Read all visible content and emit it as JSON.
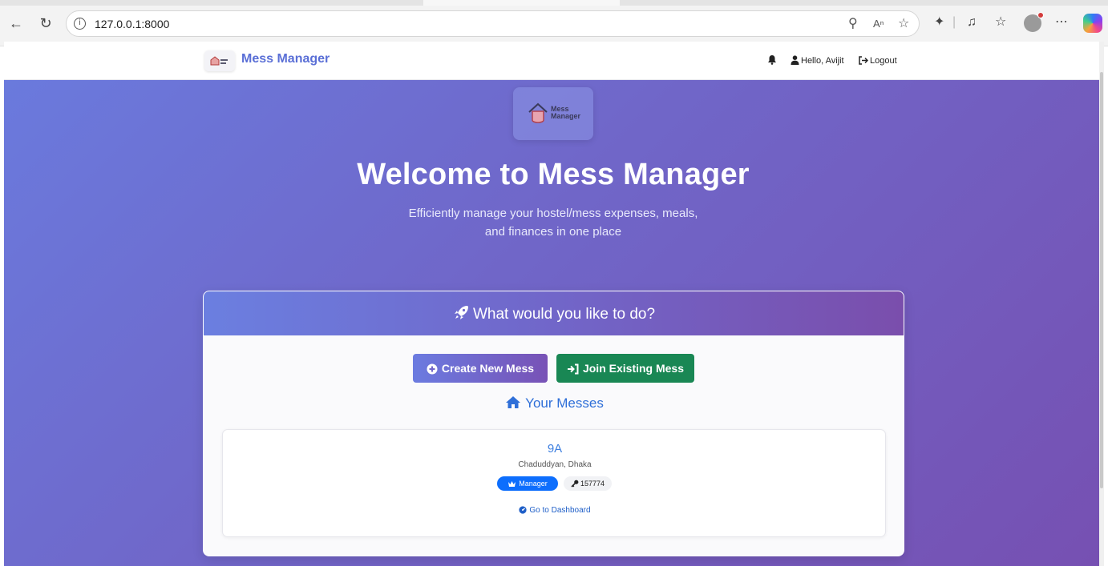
{
  "browser": {
    "url": "127.0.0.1:8000"
  },
  "navbar": {
    "brand": "Mess Manager",
    "greeting": "Hello, Avijit",
    "logout": "Logout"
  },
  "hero": {
    "logo_text_line1": "Mess",
    "logo_text_line2": "Manager",
    "title": "Welcome to Mess Manager",
    "subtitle_line1": "Efficiently manage your hostel/mess expenses, meals,",
    "subtitle_line2": "and finances in one place"
  },
  "actions": {
    "heading": "What would you like to do?",
    "create_label": "Create New Mess",
    "join_label": "Join Existing Mess"
  },
  "messes": {
    "heading": "Your Messes",
    "items": [
      {
        "name": "9A",
        "location": "Chaduddyan, Dhaka",
        "role": "Manager",
        "code": "157774",
        "link": "Go to Dashboard"
      }
    ]
  },
  "colors": {
    "brand": "#5a6fd6",
    "gradient_start": "#6a7bde",
    "gradient_end": "#7650b2",
    "join_button": "#198754",
    "role_badge": "#0d6efd"
  }
}
